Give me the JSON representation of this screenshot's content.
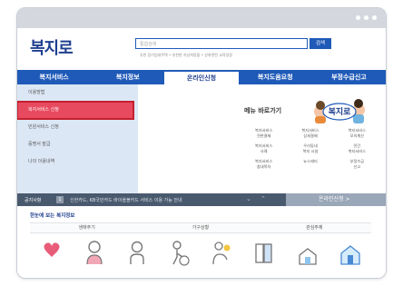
{
  "window": {
    "controls": [
      "dot",
      "dot",
      "dot"
    ]
  },
  "header": {
    "logo": "복지로",
    "search_placeholder": "통합검색",
    "search_button": "검색",
    "search_hint": "추천 장기임대주택 • 추천한 자상희망을 • 상위관련 교육일정"
  },
  "nav": {
    "items": [
      {
        "label": "복지서비스",
        "active": false
      },
      {
        "label": "복지정보",
        "active": false
      },
      {
        "label": "온라인신청",
        "active": true
      },
      {
        "label": "복지도움요청",
        "active": false
      },
      {
        "label": "부정수급신고",
        "active": false
      }
    ]
  },
  "dropdown": {
    "side_items": [
      {
        "label": "이용방법",
        "selected": false
      },
      {
        "label": "복지서비스 신청",
        "selected": true
      },
      {
        "label": "민원서비스 신청",
        "selected": false
      },
      {
        "label": "증명서 발급",
        "selected": false
      },
      {
        "label": "나의 이용내역",
        "selected": false
      }
    ],
    "menu_title": "메뉴 바로가기",
    "mascot_text": "복지로",
    "menu_cells": [
      [
        "복지서비스",
        "전현결제"
      ],
      [
        "복지서비스",
        "상세결제"
      ],
      [
        "복지서비스",
        "모의계산"
      ],
      [
        "복지서비스",
        "사례"
      ],
      [
        "우리동네",
        "복지 시설"
      ],
      [
        "민간",
        "복지서비스"
      ],
      [
        "복지서비스",
        "참내목차"
      ],
      [
        "뉴스레터"
      ],
      [
        "부정수급",
        "신고"
      ]
    ]
  },
  "notice": {
    "label": "공지사항",
    "num": "1",
    "text": "신한카드, KB국민카드 바이올볼카드 서비스 이용 가능 안내",
    "online_button": "온라인신청 >"
  },
  "lower": {
    "title": "한눈에 보는 복지정보",
    "tabs": [
      "생애주기",
      "가구상황",
      "관심주제"
    ],
    "icons": [
      "pregnancy-icon",
      "infant-icon",
      "child-icon",
      "senior-icon",
      "family-icon",
      "document-icon",
      "housing-icon",
      "house-icon"
    ]
  }
}
